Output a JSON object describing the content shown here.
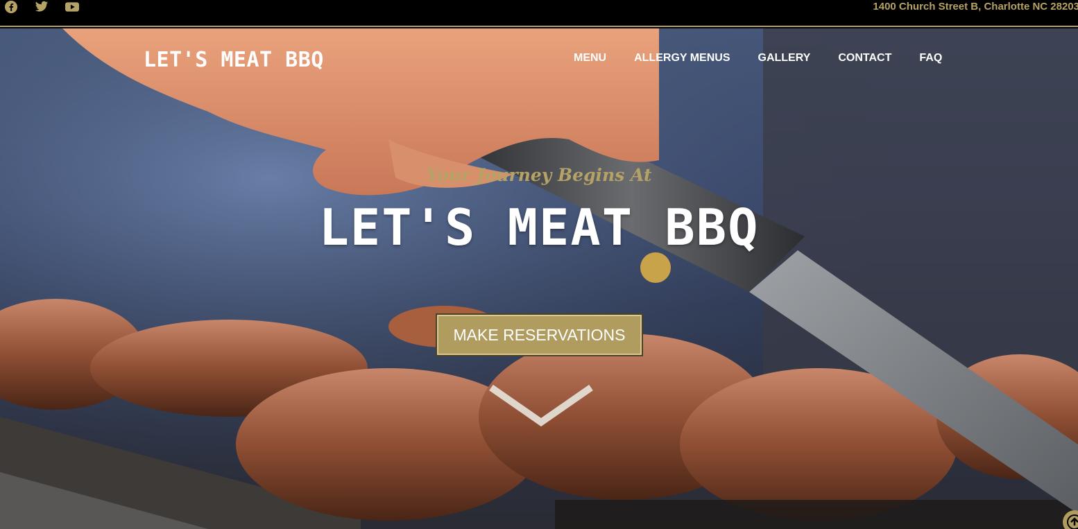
{
  "topbar": {
    "social": [
      {
        "icon": "facebook-icon"
      },
      {
        "icon": "twitter-icon"
      },
      {
        "icon": "youtube-icon"
      }
    ],
    "address": "1400 Church Street B, Charlotte NC 28203"
  },
  "header": {
    "brand": "LET'S MEAT BBQ",
    "nav": [
      "MENU",
      "ALLERGY MENUS",
      "GALLERY",
      "CONTACT",
      "FAQ"
    ]
  },
  "hero": {
    "tagline": "Your Journey Begins At",
    "headline": "LET'S MEAT BBQ",
    "cta_label": "MAKE RESERVATIONS"
  },
  "colors": {
    "accent": "#b5a266",
    "topbar_bg": "#000000",
    "text": "#ffffff"
  }
}
